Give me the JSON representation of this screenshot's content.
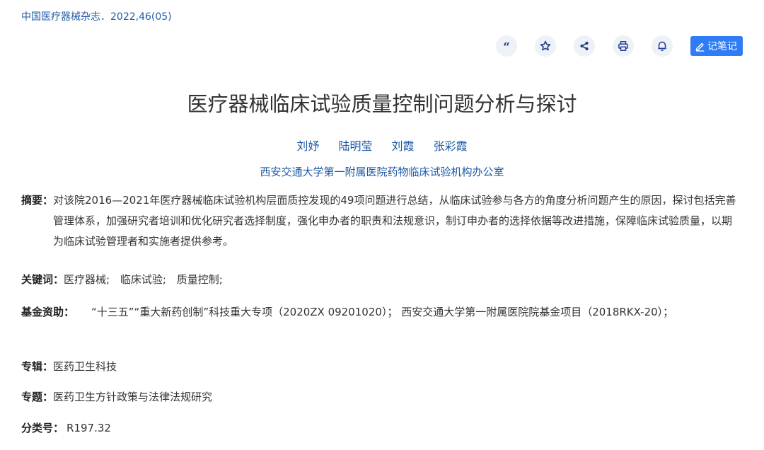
{
  "source": "中国医疗器械杂志．2022,46(05)",
  "toolbar": {
    "note_label": "记笔记"
  },
  "title": "医疗器械临床试验质量控制问题分析与探讨",
  "authors": [
    "刘妤",
    "陆明莹",
    "刘霞",
    "张彩霞"
  ],
  "affiliation": "西安交通大学第一附属医院药物临床试验机构办公室",
  "abstract": {
    "label": "摘要：",
    "text": "对该院2016—2021年医疗器械临床试验机构层面质控发现的49项问题进行总结，从临床试验参与各方的角度分析问题产生的原因，探讨包括完善管理体系，加强研究者培训和优化研究者选择制度，强化申办者的职责和法规意识，制订申办者的选择依据等改进措施，保障临床试验质量，以期为临床试验管理者和实施者提供参考。"
  },
  "keywords": {
    "label": "关键词：",
    "items": [
      "医疗器械;",
      "临床试验;",
      "质量控制;"
    ]
  },
  "funding": {
    "label": "基金资助：",
    "text": "“十三五”“重大新药创制”科技重大专项（2020ZX 09201020）； 西安交通大学第一附属医院院基金项目（2018RKX-20）；"
  },
  "album": {
    "label": "专辑：",
    "value": "医药卫生科技"
  },
  "topic": {
    "label": "专题：",
    "value": "医药卫生方针政策与法律法规研究"
  },
  "classification": {
    "label": "分类号：",
    "value": "R197.32"
  }
}
